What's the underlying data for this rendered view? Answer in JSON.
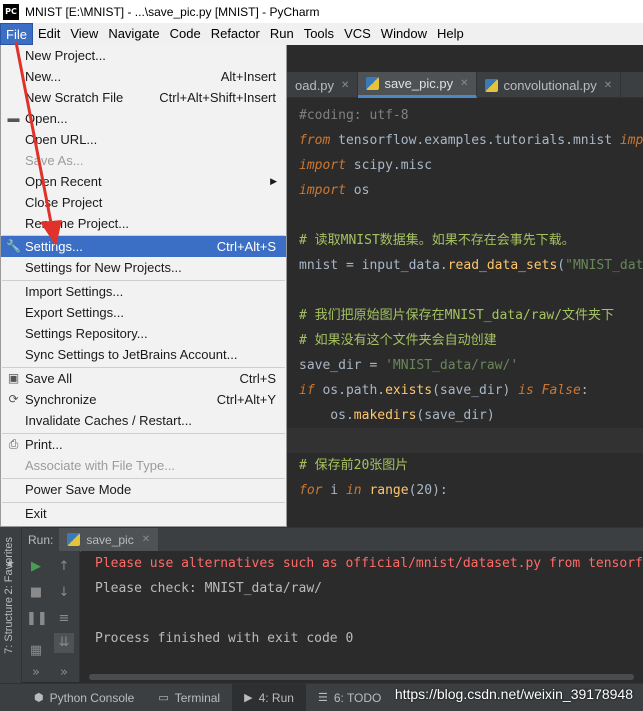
{
  "window": {
    "logo_text": "PC",
    "title": "MNIST [E:\\MNIST] - ...\\save_pic.py [MNIST] - PyCharm"
  },
  "menubar": [
    "File",
    "Edit",
    "View",
    "Navigate",
    "Code",
    "Refactor",
    "Run",
    "Tools",
    "VCS",
    "Window",
    "Help"
  ],
  "editor_tabs": [
    {
      "label": "oad.py",
      "active": false
    },
    {
      "label": "save_pic.py",
      "active": true
    },
    {
      "label": "convolutional.py",
      "active": false
    }
  ],
  "code_lines": [
    "#coding: utf-8",
    "from tensorflow.examples.tutorials.mnist import input_data",
    "import scipy.misc",
    "import os",
    "",
    "# 读取MNIST数据集。如果不存在会事先下载。",
    "mnist = input_data.read_data_sets(\"MNIST_data/\", one_hot=True)",
    "",
    "# 我们把原始图片保存在MNIST_data/raw/文件夹下",
    "# 如果没有这个文件夹会自动创建",
    "save_dir = 'MNIST_data/raw/'",
    "if os.path.exists(save_dir) is False:",
    "    os.makedirs(save_dir)",
    "",
    "# 保存前20张图片",
    "for i in range(20):"
  ],
  "file_menu": {
    "new_project": "New Project...",
    "new": "New...",
    "new_shortcut": "Alt+Insert",
    "new_scratch": "New Scratch File",
    "new_scratch_shortcut": "Ctrl+Alt+Shift+Insert",
    "open": "Open...",
    "open_url": "Open URL...",
    "save_as": "Save As...",
    "open_recent": "Open Recent",
    "close_project": "Close Project",
    "rename_project": "Rename Project...",
    "settings": "Settings...",
    "settings_shortcut": "Ctrl+Alt+S",
    "settings_new_projects": "Settings for New Projects...",
    "import_settings": "Import Settings...",
    "export_settings": "Export Settings...",
    "settings_repository": "Settings Repository...",
    "sync_settings": "Sync Settings to JetBrains Account...",
    "save_all": "Save All",
    "save_all_shortcut": "Ctrl+S",
    "synchronize": "Synchronize",
    "synchronize_shortcut": "Ctrl+Alt+Y",
    "invalidate_caches": "Invalidate Caches / Restart...",
    "print": "Print...",
    "associate": "Associate with File Type...",
    "power_save": "Power Save Mode",
    "exit": "Exit"
  },
  "run_panel": {
    "label": "Run:",
    "tab": "save_pic",
    "console": [
      {
        "text": "Please use alternatives such as official/mnist/dataset.py from tensorflow/models.",
        "type": "err"
      },
      {
        "text": "Please check: MNIST_data/raw/",
        "type": "out"
      },
      {
        "text": "",
        "type": "out"
      },
      {
        "text": "Process finished with exit code 0",
        "type": "out"
      }
    ]
  },
  "left_strip": {
    "favorites": "2: Favorites",
    "structure": "7: Structure"
  },
  "bottom_bar": {
    "python_console": "Python Console",
    "terminal": "Terminal",
    "run": "4: Run",
    "todo": "6: TODO"
  },
  "watermark": "https://blog.csdn.net/weixin_39178948",
  "colors": {
    "selection": "#3b6fc5",
    "arrow": "#e0322a"
  }
}
